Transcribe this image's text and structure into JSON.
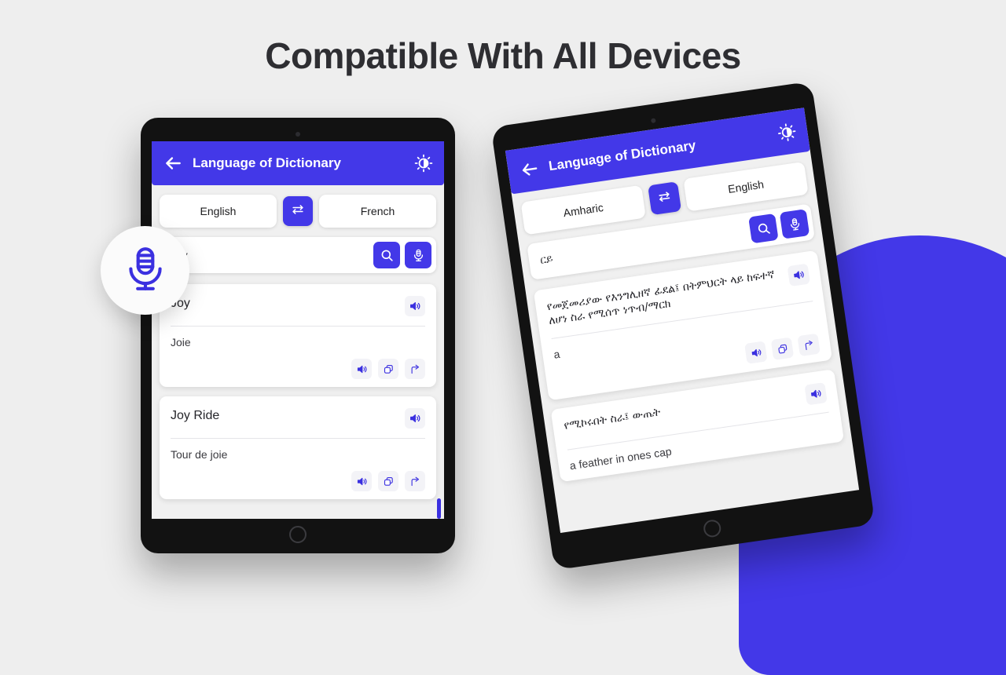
{
  "heading": "Compatible With All Devices",
  "theme": {
    "accent": "#4338e8",
    "background": "#eeeeee",
    "card": "#ffffff",
    "frame": "#121212",
    "text": "#2e2e32"
  },
  "decor": {
    "blob_color": "#4338e8",
    "mic_badge_icon": "microphone-icon"
  },
  "tablets": [
    {
      "id": "left",
      "appbar": {
        "back_icon": "arrow-left-icon",
        "title": "Language of Dictionary",
        "brightness_icon": "brightness-sun-icon"
      },
      "languages": {
        "source": "English",
        "target": "French",
        "swap_icon": "swap-horizontal-icon"
      },
      "search": {
        "value": "Joy",
        "placeholder": "Joy",
        "search_icon": "search-icon",
        "mic_icon": "microphone-icon"
      },
      "results": [
        {
          "term": "Joy",
          "translation": "Joie",
          "speak_icon": "speaker-icon",
          "actions": [
            "speaker-icon",
            "copy-icon",
            "share-icon"
          ]
        },
        {
          "term": "Joy Ride",
          "translation": "Tour de joie",
          "speak_icon": "speaker-icon",
          "actions": [
            "speaker-icon",
            "copy-icon",
            "share-icon"
          ]
        }
      ]
    },
    {
      "id": "right",
      "appbar": {
        "back_icon": "arrow-left-icon",
        "title": "Language of Dictionary",
        "brightness_icon": "brightness-sun-icon"
      },
      "languages": {
        "source": "Amharic",
        "target": "English",
        "swap_icon": "swap-horizontal-icon"
      },
      "search": {
        "value": "ርይ",
        "placeholder": "ርይ",
        "search_icon": "search-icon",
        "mic_icon": "microphone-icon"
      },
      "results": [
        {
          "term": "የመጀመሪያው የእንግሊዘኛ ፊደል፤ በትምህርት ላይ ከፍተኛ ለሆነ ስራ የሚሰጥ ነጥብ/ማርክ",
          "translation": "a",
          "speak_icon": "speaker-icon",
          "actions": [
            "speaker-icon",
            "copy-icon",
            "share-icon"
          ]
        },
        {
          "term": "የሚኮሩበት ስራ፤ ውጤት",
          "translation": "a feather in ones cap",
          "speak_icon": "speaker-icon",
          "actions": [
            "speaker-icon",
            "copy-icon",
            "share-icon"
          ]
        }
      ]
    }
  ]
}
